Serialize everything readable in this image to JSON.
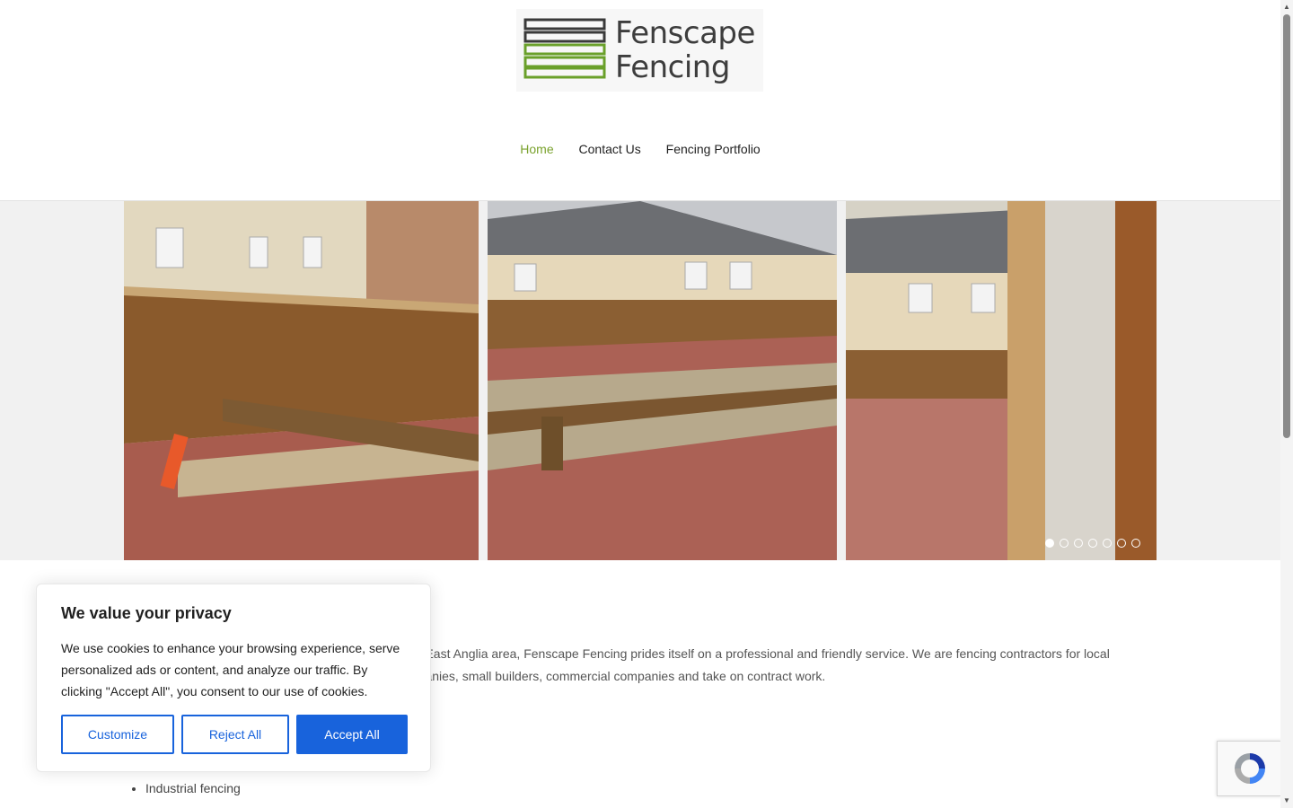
{
  "header": {
    "logo_line1": "Fenscape",
    "logo_line2": "Fencing",
    "nav": [
      {
        "label": "Home",
        "active": true
      },
      {
        "label": "Contact Us",
        "active": false
      },
      {
        "label": "Fencing Portfolio",
        "active": false
      }
    ],
    "accent_color": "#7aa22d"
  },
  "slider": {
    "slides_visible": 3,
    "dots_total": 7,
    "active_dot": 1
  },
  "content": {
    "intro_line1": "nd East Anglia area, Fenscape Fencing prides itself on a professional and friendly service. We are fencing contractors for local",
    "intro_line2": "mpanies, small builders, commercial companies and take on contract work.",
    "services": [
      "Industrial fencing"
    ]
  },
  "cookie_banner": {
    "title": "We value your privacy",
    "body": "We use cookies to enhance your browsing experience, serve personalized ads or content, and analyze our traffic. By clicking \"Accept All\", you consent to our use of cookies.",
    "customize_label": "Customize",
    "reject_label": "Reject All",
    "accept_label": "Accept All",
    "button_color": "#1863dc"
  },
  "recaptcha": {
    "icon": "recaptcha-icon"
  }
}
